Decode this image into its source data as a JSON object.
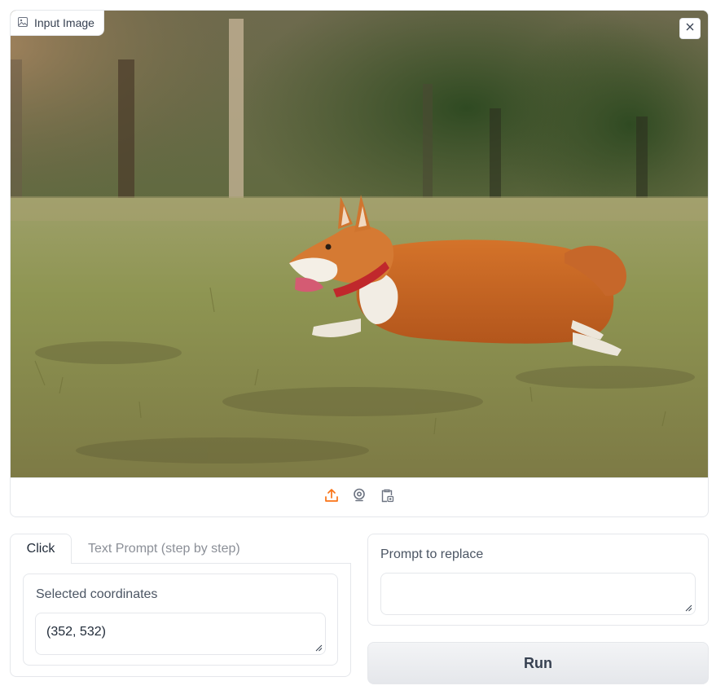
{
  "image_input": {
    "label": "Input Image",
    "label_icon": "image-icon",
    "clear_icon": "close-icon",
    "toolbar_icons": [
      "upload-icon",
      "webcam-icon",
      "clipboard-icon"
    ],
    "accent_color": "#f97316"
  },
  "tabs": [
    {
      "label": "Click",
      "selected": true
    },
    {
      "label": "Text Prompt (step by step)",
      "selected": false
    }
  ],
  "click_panel": {
    "coords_label": "Selected coordinates",
    "coords_value": "(352, 532)"
  },
  "prompt_panel": {
    "label": "Prompt to replace",
    "value": ""
  },
  "run_button": {
    "label": "Run"
  }
}
